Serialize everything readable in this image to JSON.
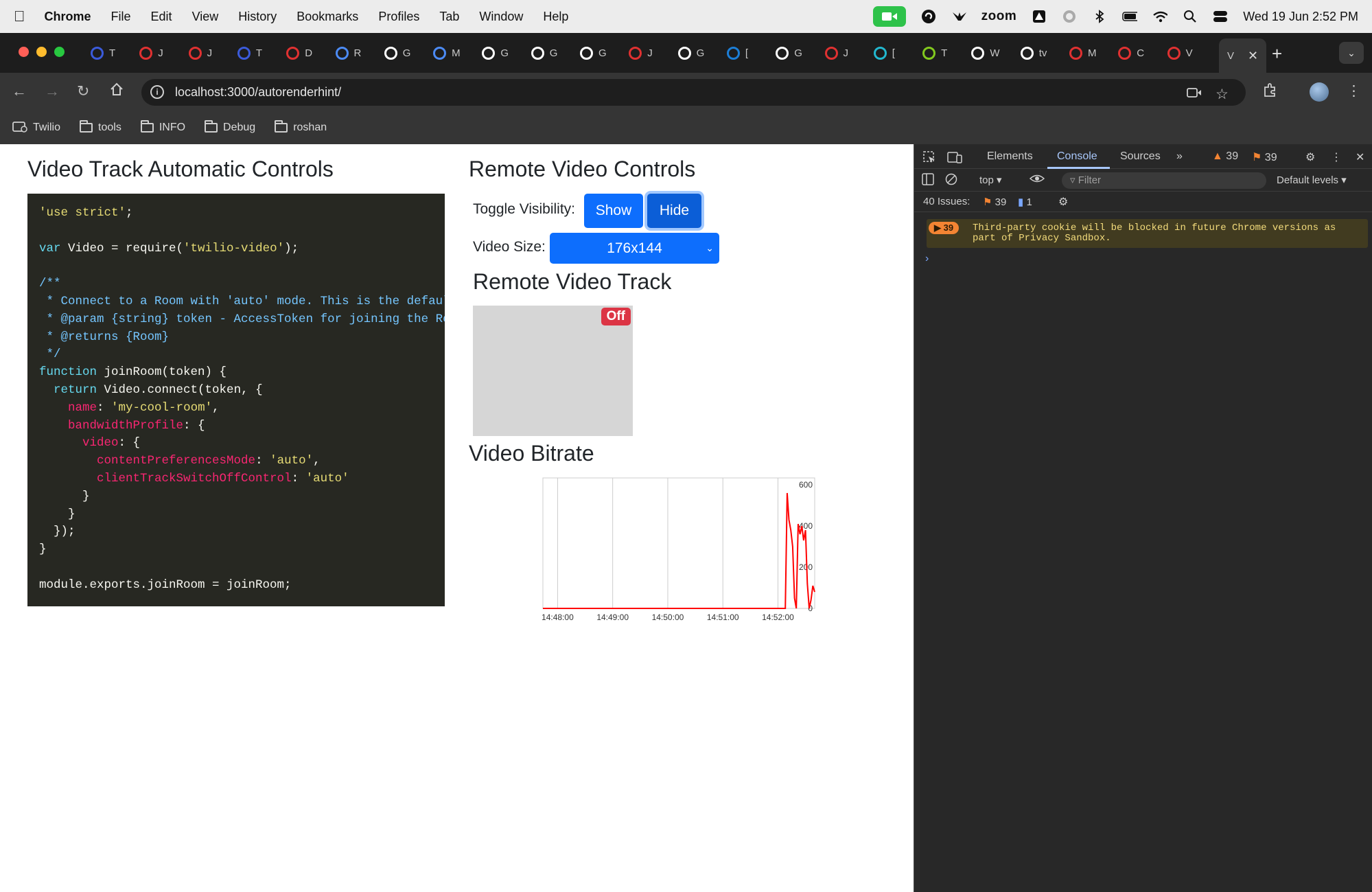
{
  "menubar": {
    "app_name": "Chrome",
    "items": [
      "File",
      "Edit",
      "View",
      "History",
      "Bookmarks",
      "Profiles",
      "Tab",
      "Window",
      "Help"
    ],
    "zoom_label": "zoom",
    "datetime": "Wed 19 Jun  2:52 PM"
  },
  "tabs": [
    {
      "label": "T",
      "color": "#3b5bdb"
    },
    {
      "label": "J",
      "color": "#e03131"
    },
    {
      "label": "J",
      "color": "#e03131"
    },
    {
      "label": "T",
      "color": "#3b5bdb"
    },
    {
      "label": "D",
      "color": "#e03131"
    },
    {
      "label": "R",
      "color": "#4c8bf5"
    },
    {
      "label": "G",
      "color": "#ffffff"
    },
    {
      "label": "M",
      "color": "#4c8bf5"
    },
    {
      "label": "G",
      "color": "#ffffff"
    },
    {
      "label": "G",
      "color": "#ffffff"
    },
    {
      "label": "G",
      "color": "#ffffff"
    },
    {
      "label": "J",
      "color": "#e03131"
    },
    {
      "label": "G",
      "color": "#ffffff"
    },
    {
      "label": "[",
      "color": "#1c7ed6"
    },
    {
      "label": "G",
      "color": "#ffffff"
    },
    {
      "label": "J",
      "color": "#e03131"
    },
    {
      "label": "[",
      "color": "#22b8cf"
    },
    {
      "label": "T",
      "color": "#82c91e"
    },
    {
      "label": "W",
      "color": "#ffffff"
    },
    {
      "label": "tv",
      "color": "#ffffff"
    },
    {
      "label": "M",
      "color": "#e03131"
    },
    {
      "label": "C",
      "color": "#e03131"
    },
    {
      "label": "V",
      "color": "#e03131"
    }
  ],
  "active_tab": {
    "label": "V"
  },
  "toolbar": {
    "url": "localhost:3000/autorenderhint/"
  },
  "bookmarks": [
    "Twilio",
    "tools",
    "INFO",
    "Debug",
    "roshan"
  ],
  "page": {
    "left_title": "Video Track Automatic Controls",
    "controls_title": "Remote Video Controls",
    "toggle_label": "Toggle Visibility:",
    "show_button": "Show",
    "hide_button": "Hide",
    "size_label": "Video Size:",
    "size_value": "176x144",
    "track_title": "Remote Video Track",
    "off_badge": "Off",
    "bitrate_title": "Video Bitrate"
  },
  "code_lines": [
    "'use strict';",
    "",
    "var Video = require('twilio-video');",
    "",
    "/**",
    " * Connect to a Room with 'auto' mode. This is the default",
    " * @param {string} token - AccessToken for joining the Room",
    " * @returns {Room}",
    " */",
    "function joinRoom(token) {",
    "  return Video.connect(token, {",
    "    name: 'my-cool-room',",
    "    bandwidthProfile: {",
    "      video: {",
    "        contentPreferencesMode: 'auto',",
    "        clientTrackSwitchOffControl: 'auto'",
    "      }",
    "    }",
    "  });",
    "}",
    "",
    "module.exports.joinRoom = joinRoom;"
  ],
  "chart_data": {
    "type": "line",
    "title": "",
    "xlabel": "",
    "ylabel": "",
    "x_ticks": [
      "14:48:00",
      "14:49:00",
      "14:50:00",
      "14:51:00",
      "14:52:00"
    ],
    "y_ticks": [
      "600",
      "400",
      "200",
      "0"
    ],
    "ylim": [
      0,
      600
    ],
    "grid": "vertical",
    "series": [
      {
        "color": "#ff0000",
        "x": [
          "14:47:44",
          "14:48:00",
          "14:49:00",
          "14:50:00",
          "14:51:00",
          "14:52:00",
          "14:52:08",
          "14:52:10",
          "14:52:12",
          "14:52:14",
          "14:52:16",
          "14:52:18",
          "14:52:20",
          "14:52:22",
          "14:52:24",
          "14:52:26",
          "14:52:28",
          "14:52:30",
          "14:52:32",
          "14:52:34",
          "14:52:36",
          "14:52:38",
          "14:52:40"
        ],
        "values": [
          0,
          0,
          0,
          0,
          0,
          0,
          0,
          560,
          430,
          380,
          300,
          50,
          0,
          410,
          360,
          400,
          330,
          380,
          120,
          0,
          40,
          110,
          80
        ]
      }
    ]
  },
  "devtools": {
    "tabs": [
      "Elements",
      "Console",
      "Sources"
    ],
    "active_tab": "Console",
    "warn_count": "39",
    "err_count": "39",
    "context": "top",
    "filter_placeholder": "Filter",
    "levels": "Default levels",
    "issues_label": "40 Issues:",
    "issues_err": "39",
    "issues_info": "1",
    "message_count": "39",
    "message_text": "Third-party cookie will be blocked in future Chrome versions as part of Privacy Sandbox."
  }
}
